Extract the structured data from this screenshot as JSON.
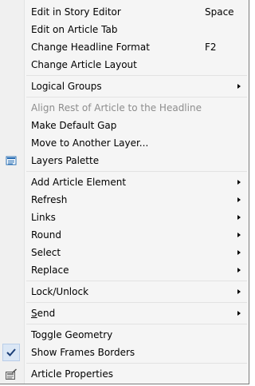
{
  "menu": {
    "items": [
      {
        "label": "Edit in Story Editor",
        "shortcut": "Space"
      },
      {
        "label": "Edit on Article Tab"
      },
      {
        "label": "Change Headline Format",
        "shortcut": "F2"
      },
      {
        "label": "Change Article Layout"
      },
      {
        "label": "Logical Groups"
      },
      {
        "label": "Align Rest of Article to the Headline",
        "state": "disabled"
      },
      {
        "label": "Make Default Gap"
      },
      {
        "label": "Move to Another Layer..."
      },
      {
        "label": "Layers Palette",
        "icon": "layers-palette-icon"
      },
      {
        "label": "Add Article Element"
      },
      {
        "label": "Refresh"
      },
      {
        "label": "Links"
      },
      {
        "label": "Round"
      },
      {
        "label": "Select"
      },
      {
        "label": "Replace"
      },
      {
        "label": "Lock/Unlock"
      },
      {
        "label_prefix": "S",
        "label_rest": "end"
      },
      {
        "label": "Toggle Geometry"
      },
      {
        "label": "Show Frames Borders",
        "checked": true,
        "icon": "checkmark-icon"
      },
      {
        "label": "Article Properties",
        "icon": "article-properties-icon"
      }
    ]
  },
  "colors": {
    "menu_bg": "#f5f5f5",
    "disabled_text": "#8d8d8d",
    "icon_blue": "#2a6fb5"
  }
}
